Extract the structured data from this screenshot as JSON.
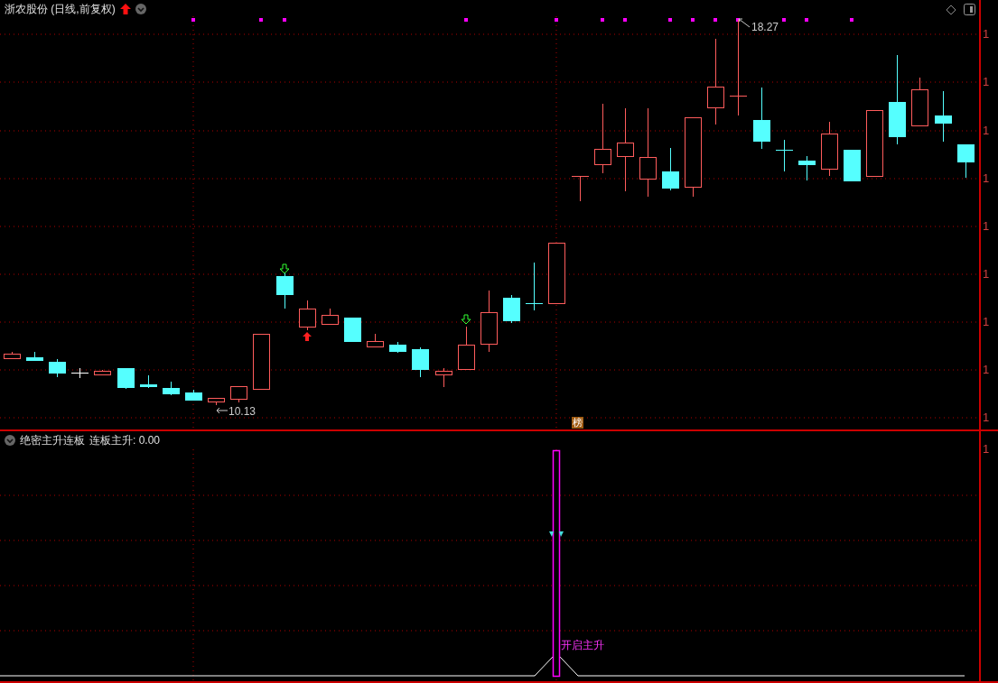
{
  "main_panel": {
    "title": "浙农股份 (日线,前复权)",
    "high_price_label": "18.27",
    "low_price_label": "10.13",
    "event_badge": "榜",
    "axis_labels": [
      "1",
      "1",
      "1",
      "1",
      "1",
      "1",
      "1",
      "1",
      "1"
    ]
  },
  "indicator_panel": {
    "name": "绝密主升连板",
    "reading": "连板主升: 0.00",
    "signal_label": "开启主升",
    "axis_labels": [
      "1"
    ]
  }
}
